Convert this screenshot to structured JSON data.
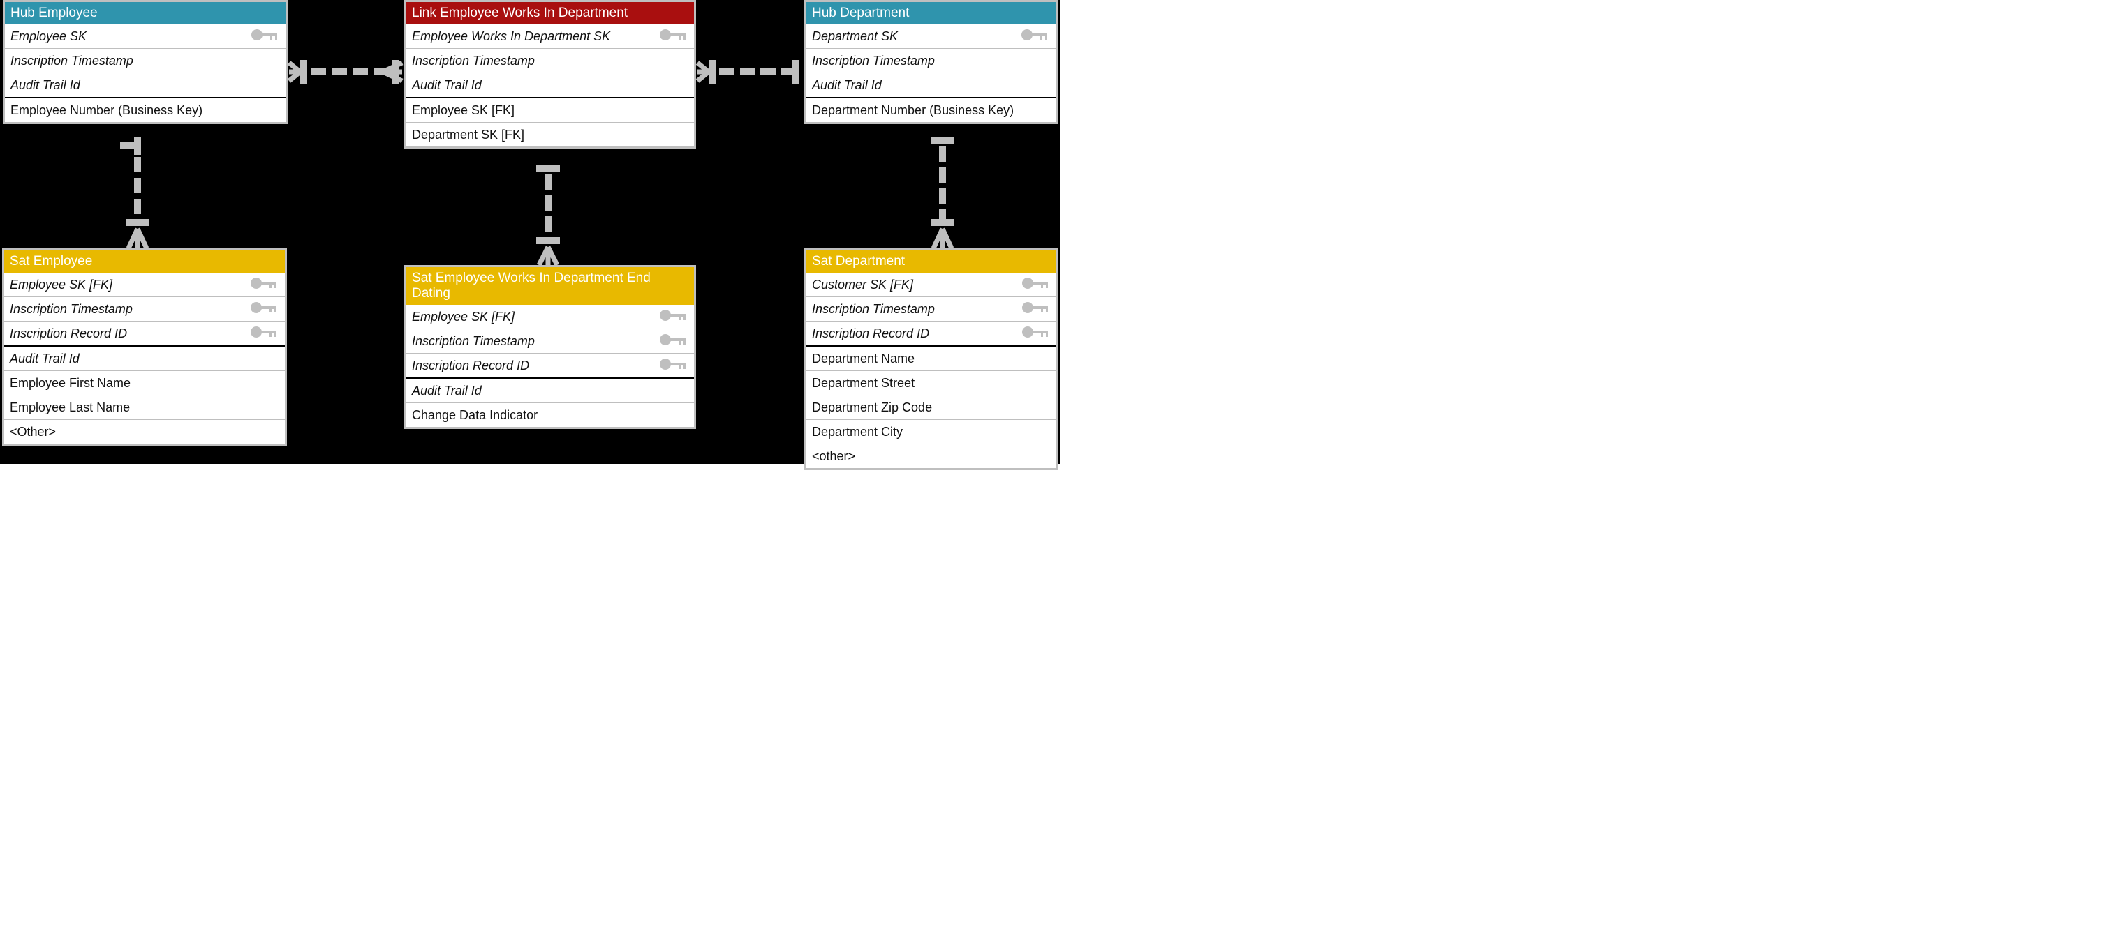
{
  "entities": {
    "hubEmployee": {
      "title": "Hub Employee",
      "rows": [
        {
          "label": "Employee SK",
          "italic": true,
          "key": true,
          "sep": false
        },
        {
          "label": "Inscription Timestamp",
          "italic": true,
          "key": false,
          "sep": false
        },
        {
          "label": "Audit Trail Id",
          "italic": true,
          "key": false,
          "sep": true
        },
        {
          "label": "Employee Number (Business Key)",
          "italic": false,
          "key": false,
          "sep": false
        }
      ]
    },
    "linkEmpDept": {
      "title": "Link Employee Works In Department",
      "rows": [
        {
          "label": "Employee Works In Department SK",
          "italic": true,
          "key": true,
          "sep": false
        },
        {
          "label": "Inscription Timestamp",
          "italic": true,
          "key": false,
          "sep": false
        },
        {
          "label": "Audit Trail Id",
          "italic": true,
          "key": false,
          "sep": true
        },
        {
          "label": "Employee SK [FK]",
          "italic": false,
          "key": false,
          "sep": false
        },
        {
          "label": "Department SK [FK]",
          "italic": false,
          "key": false,
          "sep": false
        }
      ]
    },
    "hubDepartment": {
      "title": "Hub Department",
      "rows": [
        {
          "label": "Department SK",
          "italic": true,
          "key": true,
          "sep": false
        },
        {
          "label": "Inscription Timestamp",
          "italic": true,
          "key": false,
          "sep": false
        },
        {
          "label": "Audit Trail Id",
          "italic": true,
          "key": false,
          "sep": true
        },
        {
          "label": "Department Number (Business Key)",
          "italic": false,
          "key": false,
          "sep": false
        }
      ]
    },
    "satEmployee": {
      "title": "Sat Employee",
      "rows": [
        {
          "label": "Employee SK [FK]",
          "italic": true,
          "key": true,
          "sep": false
        },
        {
          "label": "Inscription Timestamp",
          "italic": true,
          "key": true,
          "sep": false
        },
        {
          "label": "Inscription Record ID",
          "italic": true,
          "key": true,
          "sep": true
        },
        {
          "label": "Audit Trail Id",
          "italic": true,
          "key": false,
          "sep": false
        },
        {
          "label": "Employee First Name",
          "italic": false,
          "key": false,
          "sep": false
        },
        {
          "label": "Employee Last Name",
          "italic": false,
          "key": false,
          "sep": false
        },
        {
          "label": "<Other>",
          "italic": false,
          "key": false,
          "sep": false
        }
      ]
    },
    "satEmpDeptEnd": {
      "title": "Sat Employee Works In Department End Dating",
      "rows": [
        {
          "label": "Employee SK [FK]",
          "italic": true,
          "key": true,
          "sep": false
        },
        {
          "label": "Inscription Timestamp",
          "italic": true,
          "key": true,
          "sep": false
        },
        {
          "label": "Inscription Record ID",
          "italic": true,
          "key": true,
          "sep": true
        },
        {
          "label": "Audit Trail Id",
          "italic": true,
          "key": false,
          "sep": false
        },
        {
          "label": "Change Data Indicator",
          "italic": false,
          "key": false,
          "sep": false
        }
      ]
    },
    "satDepartment": {
      "title": "Sat Department",
      "rows": [
        {
          "label": "Customer SK [FK]",
          "italic": true,
          "key": true,
          "sep": false
        },
        {
          "label": "Inscription Timestamp",
          "italic": true,
          "key": true,
          "sep": false
        },
        {
          "label": "Inscription Record ID",
          "italic": true,
          "key": true,
          "sep": true
        },
        {
          "label": "Department Name",
          "italic": false,
          "key": false,
          "sep": false
        },
        {
          "label": "Department Street",
          "italic": false,
          "key": false,
          "sep": false
        },
        {
          "label": "Department Zip Code",
          "italic": false,
          "key": false,
          "sep": false
        },
        {
          "label": "Department City",
          "italic": false,
          "key": false,
          "sep": false
        },
        {
          "label": "<other>",
          "italic": false,
          "key": false,
          "sep": false
        }
      ]
    }
  },
  "colors": {
    "hub": "#2f94ad",
    "link": "#a90f0f",
    "sat": "#e8b900",
    "connector": "#bfbfbf"
  }
}
